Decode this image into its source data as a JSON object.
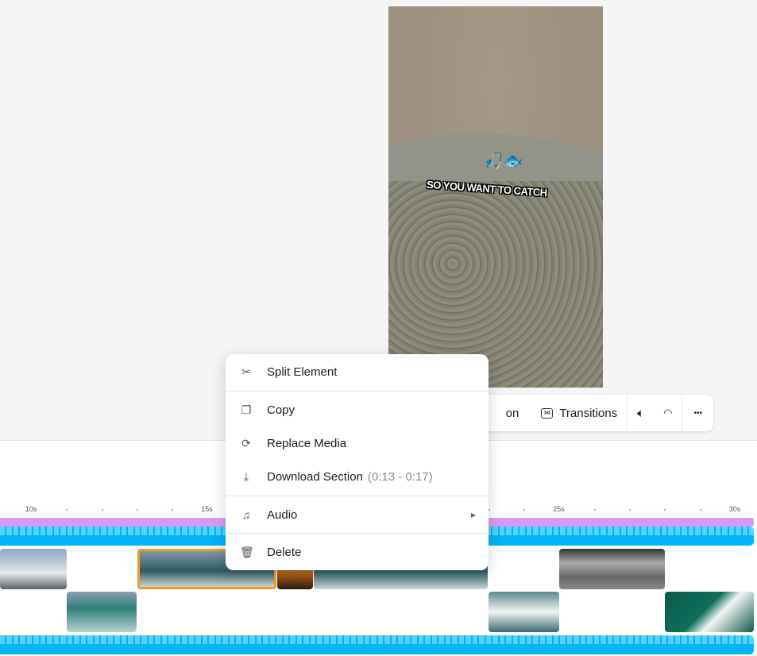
{
  "preview": {
    "caption": "SO YOU WANT TO CATCH",
    "emoji": "🎣🐟"
  },
  "toolbar": {
    "partial_label": "on",
    "transitions": "Transitions",
    "icons": [
      "transitions-icon",
      "volume-icon",
      "speed-icon",
      "more-icon"
    ],
    "more": "•••"
  },
  "timeline": {
    "ticks": [
      {
        "label": "10s",
        "sec": 10
      },
      {
        "label": "15s",
        "sec": 15
      },
      {
        "label": "25s",
        "sec": 25
      },
      {
        "label": "30s",
        "sec": 30
      }
    ],
    "selected_clip_color": "#f59a23",
    "text_track_color": "#d79af2",
    "audio_color": "#00b4f5"
  },
  "context_menu": {
    "split": "Split Element",
    "copy": "Copy",
    "replace": "Replace Media",
    "download": "Download Section",
    "download_range": "(0:13 - 0:17)",
    "audio": "Audio",
    "delete": "Delete"
  }
}
